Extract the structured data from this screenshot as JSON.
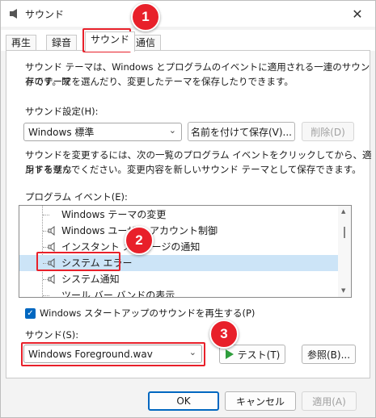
{
  "window": {
    "title": "サウンド",
    "close_label": "✕"
  },
  "tabs": [
    {
      "label": "再生"
    },
    {
      "label": "録音"
    },
    {
      "label": "サウンド"
    },
    {
      "label": "通信"
    }
  ],
  "panel": {
    "description": "サウンド テーマは、Windows とプログラムのイベントに適用される一連のサウンドです。既存のテーマを選んだり、変更したテーマを保存したりできます。",
    "desc_line1": "サウンド テーマは、Windows とプログラムのイベントに適用される一連のサウンドです。既",
    "desc_line2": "存のテーマを選んだり、変更したテーマを保存したりできます。",
    "scheme_label": "サウンド設定(H):",
    "scheme_value": "Windows 標準",
    "save_as_label": "名前を付けて保存(V)...",
    "delete_label": "削除(D)",
    "change_line1": "サウンドを変更するには、次の一覧のプログラム イベントをクリックしてから、適用するサウ",
    "change_line2": "ンドを選んでください。変更内容を新しいサウンド テーマとして保存できます。",
    "events_label": "プログラム イベント(E):",
    "events": [
      {
        "label": "Windows テーマの変更"
      },
      {
        "label": "Windows ユーザー アカウント制御"
      },
      {
        "label": "インスタント メッセージの通知"
      },
      {
        "label": "システム エラー"
      },
      {
        "label": "システム通知"
      },
      {
        "label": "ツール バー バンドの表示"
      }
    ],
    "startup_checkbox_label": "Windows スタートアップのサウンドを再生する(P)",
    "startup_checked": true,
    "sounds_label": "サウンド(S):",
    "sound_value": "Windows Foreground.wav",
    "test_label": "テスト(T)",
    "browse_label": "参照(B)..."
  },
  "footer": {
    "ok_label": "OK",
    "cancel_label": "キャンセル",
    "apply_label": "適用(A)"
  },
  "annotations": {
    "step1": "1",
    "step2": "2",
    "step3": "3",
    "color": "#e8202a"
  }
}
